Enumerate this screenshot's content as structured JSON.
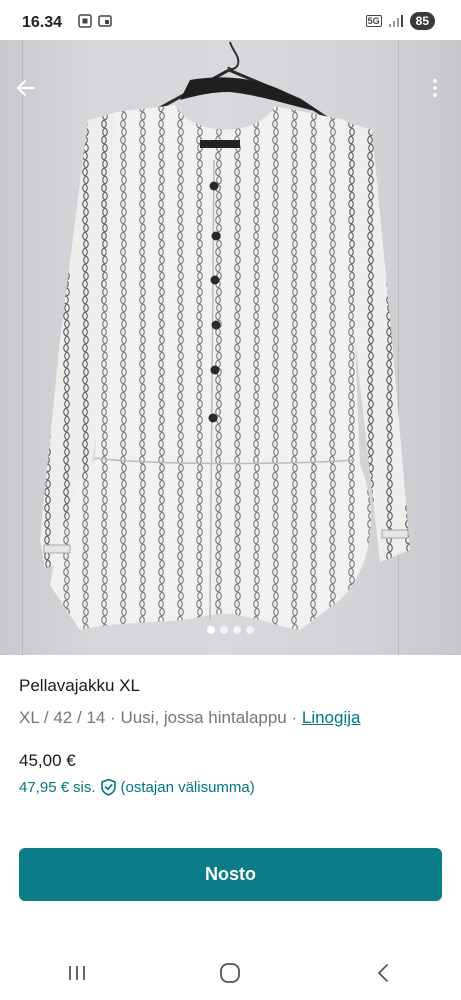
{
  "status_bar": {
    "time": "16.34",
    "network": "5G",
    "battery": "85"
  },
  "gallery": {
    "image_count": 4,
    "active_index": 0
  },
  "product": {
    "title": "Pellavajakku XL",
    "size": "XL / 42 / 14",
    "separator_1": " · ",
    "condition": "Uusi, jossa hintalappu",
    "separator_2": " · ",
    "brand": "Linogija",
    "price": "45,00 €",
    "price_incl": "47,95 €",
    "price_incl_suffix": "sis.",
    "price_incl_note": "(ostajan välisumma)"
  },
  "actions": {
    "buy_label": "Nosto"
  },
  "colors": {
    "accent": "#0b7d86",
    "link": "#007782"
  }
}
